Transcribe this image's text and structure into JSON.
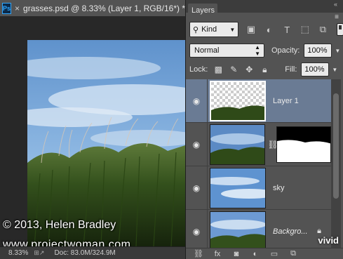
{
  "document": {
    "close_glyph": "×",
    "title": "grasses.psd @ 8.33% (Layer 1, RGB/16*) *",
    "ps_logo": "Ps"
  },
  "canvas": {
    "watermark_line1": "© 2013, Helen Bradley",
    "watermark_line2": "www.projectwoman.com"
  },
  "status_bar": {
    "zoom": "8.33%",
    "doc_info": "Doc: 83.0M/324.9M"
  },
  "layers_panel": {
    "tab_label": "Layers",
    "collapse_glyph": "«",
    "menu_glyph": "≡",
    "filter_kind": "Kind",
    "blend_mode": "Normal",
    "opacity_label": "Opacity:",
    "opacity_value": "100%",
    "lock_label": "Lock:",
    "fill_label": "Fill:",
    "fill_value": "100%",
    "layers": [
      {
        "name": "Layer 1",
        "active": true,
        "italic": false,
        "has_mask": false,
        "locked": false
      },
      {
        "name": "",
        "active": false,
        "italic": false,
        "has_mask": true,
        "locked": false
      },
      {
        "name": "sky",
        "active": false,
        "italic": false,
        "has_mask": false,
        "locked": false
      },
      {
        "name": "Backgro...",
        "active": false,
        "italic": true,
        "has_mask": false,
        "locked": true
      }
    ]
  },
  "overlay_mark": "vivid",
  "colors": {
    "panel_bg": "#535353",
    "active_layer": "#6a7b94",
    "canvas_bg": "#282828",
    "sky": "#6f9fd2",
    "grass": "#3c5a22"
  }
}
